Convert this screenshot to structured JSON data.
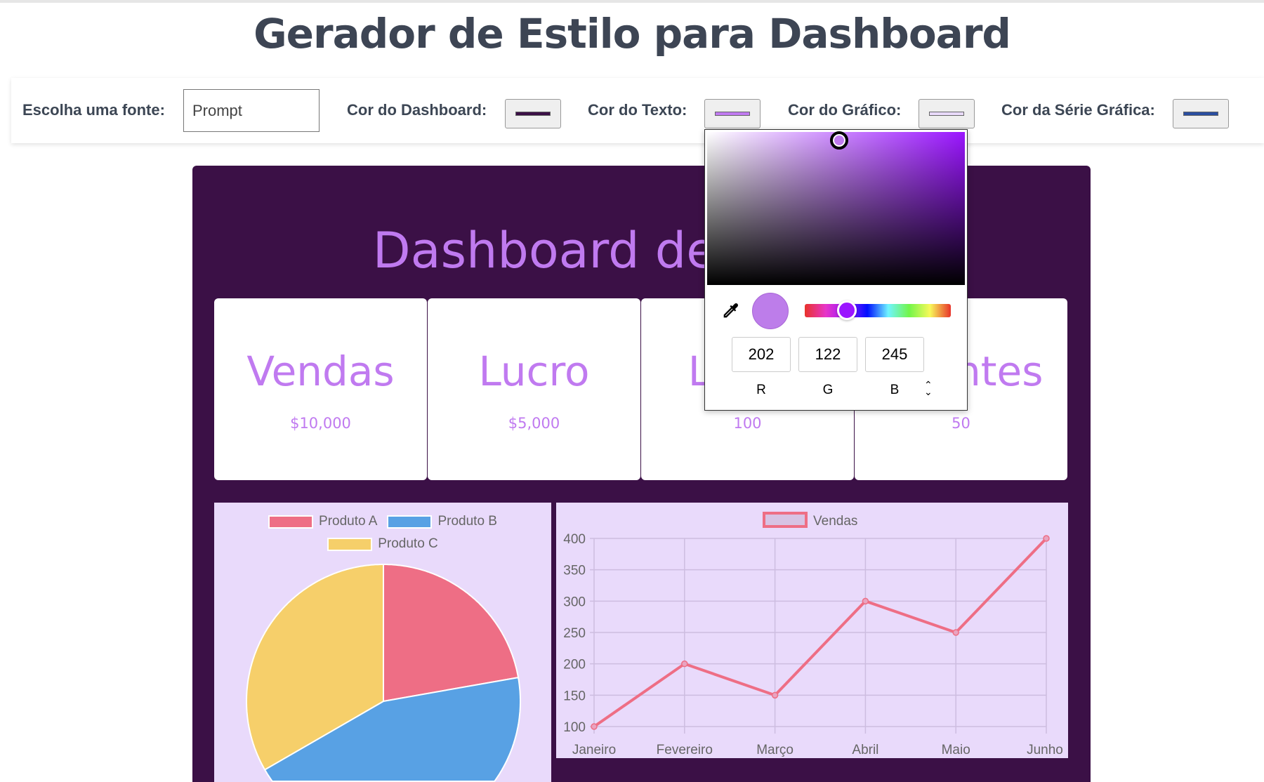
{
  "page_title": "Gerador de Estilo para Dashboard",
  "toolbar": {
    "font_label": "Escolha uma fonte:",
    "font_value": "Prompt",
    "dashboard_color_label": "Cor do Dashboard:",
    "dashboard_color": "#3b1046",
    "text_color_label": "Cor do Texto:",
    "text_color": "#ca7af5",
    "chart_color_label": "Cor do Gráfico:",
    "chart_color": "#e9dafb",
    "series_color_label": "Cor da Série Gráfica:",
    "series_color": "#2a4ea0"
  },
  "color_picker": {
    "r": "202",
    "g": "122",
    "b": "245",
    "r_label": "R",
    "g_label": "G",
    "b_label": "B",
    "eyedropper_icon": "eyedropper-icon",
    "mode_toggle_icon": "chevron-up-down-icon"
  },
  "dashboard": {
    "title": "Dashboard de Vendas",
    "cards": [
      {
        "title": "Vendas",
        "value": "$10,000"
      },
      {
        "title": "Lucro",
        "value": "$5,000"
      },
      {
        "title": "Leads",
        "value": "100"
      },
      {
        "title": "Clientes",
        "value": "50"
      }
    ]
  },
  "chart_data": [
    {
      "type": "pie",
      "legend": "top",
      "categories": [
        "Produto A",
        "Produto B",
        "Produto C"
      ],
      "values": [
        100,
        200,
        150
      ],
      "colors": [
        "#ee6e85",
        "#58a1e4",
        "#f6cf6a"
      ]
    },
    {
      "type": "line",
      "legend": "top",
      "series": [
        {
          "name": "Vendas",
          "values": [
            100,
            200,
            150,
            300,
            250,
            400
          ],
          "color": "#ee6e85"
        }
      ],
      "categories": [
        "Janeiro",
        "Fevereiro",
        "Março",
        "Abril",
        "Maio",
        "Junho"
      ],
      "ylim": [
        100,
        400
      ],
      "yticks": [
        "100",
        "150",
        "200",
        "250",
        "300",
        "350",
        "400"
      ],
      "grid": true
    }
  ]
}
